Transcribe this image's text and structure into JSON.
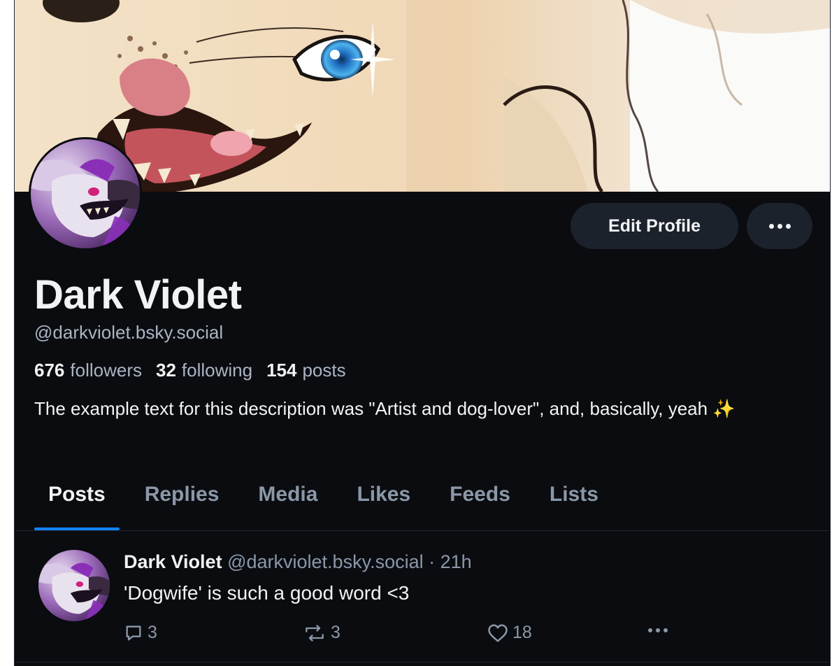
{
  "profile": {
    "display_name": "Dark Violet",
    "handle": "@darkviolet.bsky.social",
    "followers_count": "676",
    "followers_label": "followers",
    "following_count": "32",
    "following_label": "following",
    "posts_count": "154",
    "posts_label": "posts",
    "bio": "The example text for this description was \"Artist and dog-lover\", and, basically, yeah ✨"
  },
  "buttons": {
    "edit_profile": "Edit Profile",
    "more_icon": "ellipsis-icon"
  },
  "tabs": [
    {
      "label": "Posts",
      "active": true
    },
    {
      "label": "Replies",
      "active": false
    },
    {
      "label": "Media",
      "active": false
    },
    {
      "label": "Likes",
      "active": false
    },
    {
      "label": "Feeds",
      "active": false
    },
    {
      "label": "Lists",
      "active": false
    }
  ],
  "post": {
    "author_name": "Dark Violet",
    "author_handle": "@darkviolet.bsky.social",
    "separator": "·",
    "time": "21h",
    "text": "'Dogwife' is such a good word <3",
    "reply_count": "3",
    "repost_count": "3",
    "like_count": "18"
  },
  "colors": {
    "background": "#0a0c10",
    "accent": "#1083fe",
    "text_primary": "#f1f3f5",
    "text_secondary": "#8b98a8"
  }
}
